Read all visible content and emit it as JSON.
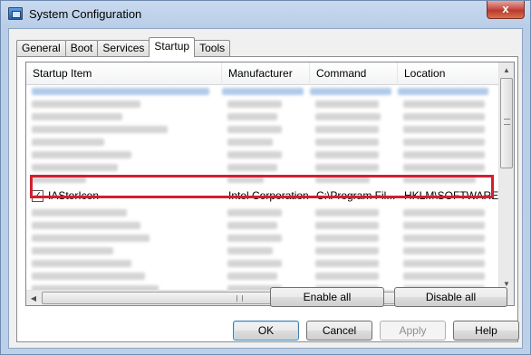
{
  "window": {
    "title": "System Configuration",
    "close_label": "x"
  },
  "tabs": [
    {
      "label": "General"
    },
    {
      "label": "Boot"
    },
    {
      "label": "Services"
    },
    {
      "label": "Startup"
    },
    {
      "label": "Tools"
    }
  ],
  "active_tab": "Startup",
  "columns": [
    "Startup Item",
    "Manufacturer",
    "Command",
    "Location"
  ],
  "highlighted_row": {
    "checked": true,
    "startup_item": "IAStorIcon",
    "manufacturer": "Intel Corporation",
    "command": "C:\\Program Fil...",
    "location": "HKLM\\SOFTWARE\\..."
  },
  "buttons": {
    "enable_all": "Enable all",
    "disable_all": "Disable all",
    "ok": "OK",
    "cancel": "Cancel",
    "apply": "Apply",
    "help": "Help"
  },
  "colors": {
    "highlight_box": "#d21f2f",
    "selection_blue": "#a7c4e6"
  },
  "icons": {
    "window": "msconfig-icon",
    "close": "close-icon"
  }
}
